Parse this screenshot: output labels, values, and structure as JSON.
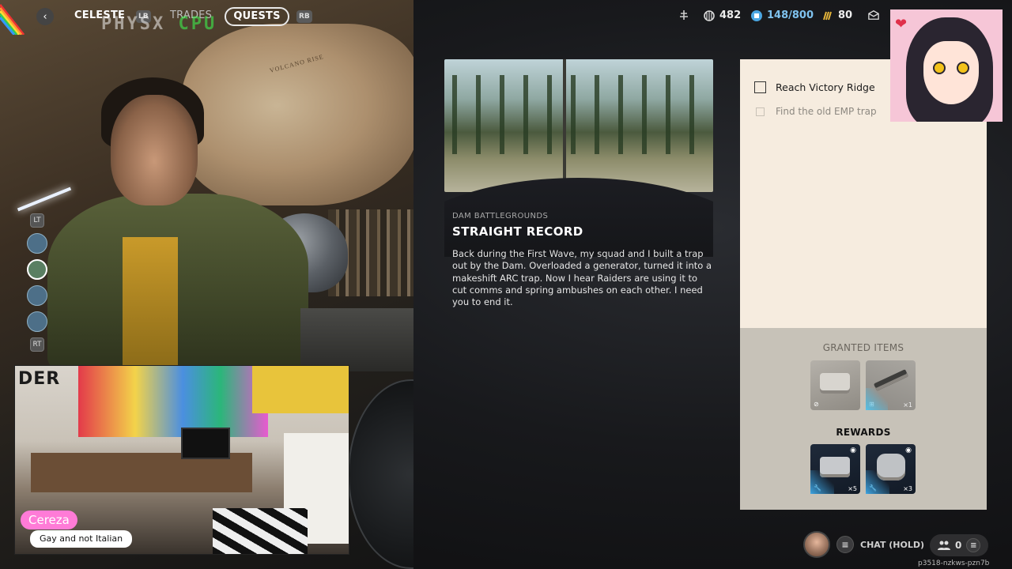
{
  "nav": {
    "tabs": [
      "CELESTE",
      "TRADES",
      "QUESTS"
    ],
    "hint_left": "LB",
    "hint_right": "RB",
    "watermark_a": "PHYSX",
    "watermark_b": "CPU"
  },
  "currencies": {
    "raider_tokens": "482",
    "stash": "148/800",
    "coins": "80"
  },
  "quest": {
    "location": "DAM BATTLEGROUNDS",
    "title": "STRAIGHT RECORD",
    "description": "Back during the First Wave, my squad and I built a trap out by the Dam. Overloaded a generator, turned it into a makeshift ARC trap. Now I hear Raiders are using it to cut comms and spring ambushes on each other. I need you to end it."
  },
  "objectives": [
    {
      "label": "Reach Victory Ridge",
      "completed": false,
      "active": true
    },
    {
      "label": "Find the old EMP trap",
      "completed": false,
      "active": false
    }
  ],
  "granted": {
    "title": "GRANTED ITEMS",
    "items": [
      {
        "icon": "ammo-case-icon",
        "qty": ""
      },
      {
        "icon": "rifle-icon",
        "qty": "×1"
      }
    ]
  },
  "rewards": {
    "title": "REWARDS",
    "items": [
      {
        "icon": "toolbox-icon",
        "qty": "×5"
      },
      {
        "icon": "device-icon",
        "qty": "×3"
      }
    ]
  },
  "side_hints": {
    "top": "LT",
    "bottom": "RT"
  },
  "stream": {
    "name": "Cereza",
    "subtitle": "Gay and not Italian",
    "sign": "DER"
  },
  "bottom": {
    "chat_label": "CHAT (HOLD)",
    "party_count": "0",
    "session_id": "p3518-nzkws-pzn7b"
  },
  "colors": {
    "accent_blue": "#3da3e0",
    "panel_cream": "#f6ecdf",
    "panel_grey": "#c7c2b8",
    "name_pink": "#ff7bd7"
  }
}
